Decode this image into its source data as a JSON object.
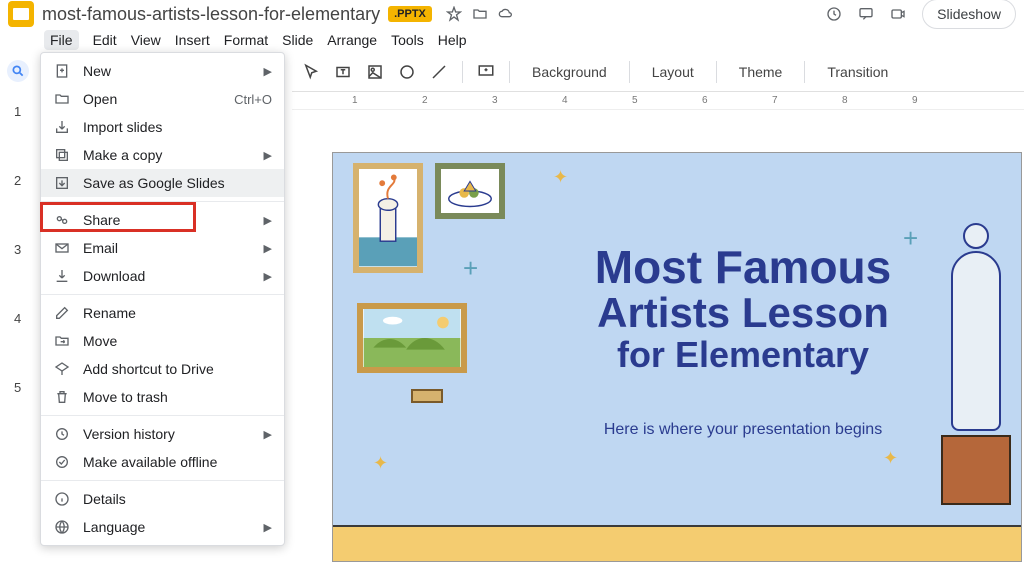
{
  "header": {
    "doc_title": "most-famous-artists-lesson-for-elementary",
    "badge": ".PPTX",
    "slideshow_label": "Slideshow"
  },
  "menubar": [
    "File",
    "Edit",
    "View",
    "Insert",
    "Format",
    "Slide",
    "Arrange",
    "Tools",
    "Help"
  ],
  "file_menu": {
    "items": [
      {
        "label": "New",
        "arrow": true
      },
      {
        "label": "Open",
        "shortcut": "Ctrl+O"
      },
      {
        "label": "Import slides"
      },
      {
        "label": "Make a copy",
        "arrow": true
      },
      {
        "label": "Save as Google Slides",
        "highlight": true
      },
      {
        "sep": true
      },
      {
        "label": "Share",
        "arrow": true
      },
      {
        "label": "Email",
        "arrow": true
      },
      {
        "label": "Download",
        "arrow": true
      },
      {
        "sep": true
      },
      {
        "label": "Rename"
      },
      {
        "label": "Move"
      },
      {
        "label": "Add shortcut to Drive"
      },
      {
        "label": "Move to trash"
      },
      {
        "sep": true
      },
      {
        "label": "Version history",
        "arrow": true
      },
      {
        "label": "Make available offline"
      },
      {
        "sep": true
      },
      {
        "label": "Details"
      },
      {
        "label": "Language",
        "arrow": true
      }
    ]
  },
  "toolbar": {
    "background": "Background",
    "layout": "Layout",
    "theme": "Theme",
    "transition": "Transition"
  },
  "ruler_marks": [
    "1",
    "2",
    "3",
    "4",
    "5",
    "6",
    "7",
    "8",
    "9"
  ],
  "thumbnails": [
    "1",
    "2",
    "3",
    "4",
    "5"
  ],
  "slide": {
    "line1": "Most Famous",
    "line2": "Artists Lesson",
    "line3": "for Elementary",
    "subtitle": "Here is where your presentation begins"
  }
}
